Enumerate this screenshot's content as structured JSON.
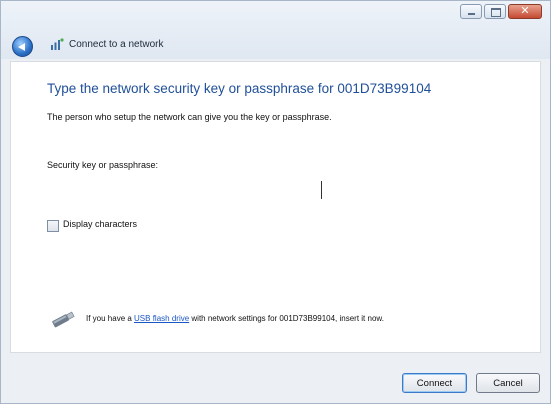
{
  "window": {
    "title": "Connect to a network",
    "controls": {
      "minimize": "minimize",
      "maximize": "maximize",
      "close": "close"
    }
  },
  "header": {
    "back_icon": "back-arrow-icon",
    "net_icon": "wireless-network-icon"
  },
  "main": {
    "heading": "Type the network security key or passphrase for 001D73B99104",
    "description": "The person who setup the network can give you the key or passphrase.",
    "key_label": "Security key or passphrase:",
    "key_value": "",
    "display_characters_label": "Display characters",
    "display_characters_checked": false,
    "usb_hint_prefix": "If you have a ",
    "usb_link": "USB flash drive",
    "usb_hint_suffix": " with network settings for 001D73B99104, insert it now."
  },
  "footer": {
    "connect_label": "Connect",
    "cancel_label": "Cancel"
  },
  "colors": {
    "heading": "#1f4f99",
    "link": "#1a56c4",
    "close_button": "#c54a33"
  }
}
